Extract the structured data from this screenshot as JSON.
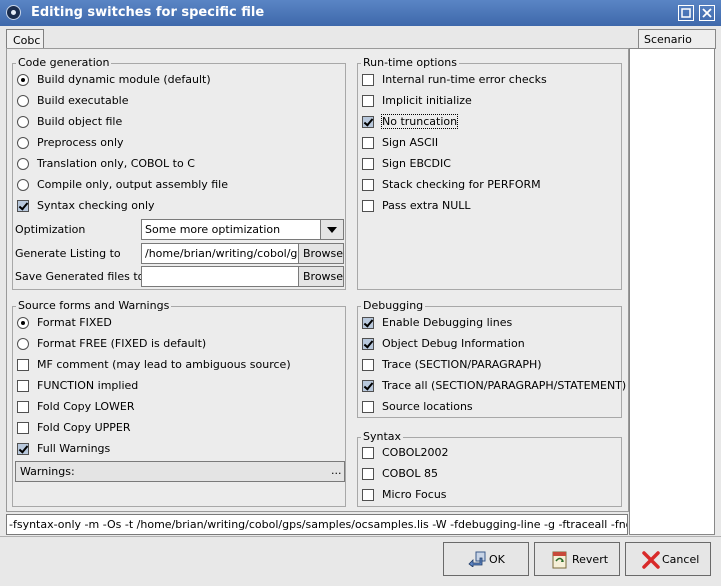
{
  "window": {
    "title": "Editing switches for specific file"
  },
  "tabs": [
    {
      "label": "Cobc"
    }
  ],
  "scenario": {
    "header": "Scenario"
  },
  "code_generation": {
    "title": "Code generation",
    "radios": [
      {
        "label": "Build dynamic module (default)",
        "selected": true
      },
      {
        "label": "Build executable",
        "selected": false
      },
      {
        "label": "Build object file",
        "selected": false
      },
      {
        "label": "Preprocess only",
        "selected": false
      },
      {
        "label": "Translation only, COBOL to C",
        "selected": false
      },
      {
        "label": "Compile only, output assembly file",
        "selected": false
      }
    ],
    "syntax_only": {
      "label": "Syntax checking only",
      "checked": true
    },
    "optimization": {
      "label": "Optimization",
      "value": "Some more optimization"
    },
    "listing": {
      "label": "Generate Listing to",
      "value": "/home/brian/writing/cobol/gps/samples/ocsamples.lis",
      "button": "Browse"
    },
    "save_generated": {
      "label": "Save Generated files to",
      "value": "",
      "button": "Browse"
    }
  },
  "runtime_options": {
    "title": "Run-time options",
    "items": [
      {
        "label": "Internal run-time error checks",
        "checked": false
      },
      {
        "label": "Implicit initialize",
        "checked": false
      },
      {
        "label": "No truncation",
        "checked": true
      },
      {
        "label": "Sign ASCII",
        "checked": false
      },
      {
        "label": "Sign EBCDIC",
        "checked": false
      },
      {
        "label": "Stack checking for PERFORM",
        "checked": false
      },
      {
        "label": "Pass extra NULL",
        "checked": false
      }
    ]
  },
  "source_forms": {
    "title": "Source forms and Warnings",
    "radios": [
      {
        "label": "Format FIXED",
        "selected": true
      },
      {
        "label": "Format FREE (FIXED is default)",
        "selected": false
      }
    ],
    "checks": [
      {
        "label": "MF comment (may lead to ambiguous source)",
        "checked": false
      },
      {
        "label": "FUNCTION implied",
        "checked": false
      },
      {
        "label": "Fold Copy LOWER",
        "checked": false
      },
      {
        "label": "Fold Copy UPPER",
        "checked": false
      },
      {
        "label": "Full Warnings",
        "checked": true
      }
    ],
    "warnings": {
      "label": "Warnings:",
      "button": "..."
    }
  },
  "debugging": {
    "title": "Debugging",
    "items": [
      {
        "label": "Enable Debugging lines",
        "checked": true
      },
      {
        "label": "Object Debug Information",
        "checked": true
      },
      {
        "label": "Trace (SECTION/PARAGRAPH)",
        "checked": false
      },
      {
        "label": "Trace all (SECTION/PARAGRAPH/STATEMENT)",
        "checked": true
      },
      {
        "label": "Source locations",
        "checked": false
      }
    ]
  },
  "syntax": {
    "title": "Syntax",
    "items": [
      {
        "label": "COBOL2002",
        "checked": false
      },
      {
        "label": "COBOL 85",
        "checked": false
      },
      {
        "label": "Micro Focus",
        "checked": false
      }
    ]
  },
  "command_line": "-fsyntax-only -m -Os -t /home/brian/writing/cobol/gps/samples/ocsamples.lis -W -fdebugging-line -g -ftraceall -fnotrunc",
  "buttons": {
    "ok": "OK",
    "revert": "Revert",
    "cancel": "Cancel"
  },
  "icons": {
    "app": "app-menu-icon",
    "maximize": "maximize-icon",
    "close": "close-icon",
    "dropdown": "chevron-down-icon",
    "ok": "ok-arrow-icon",
    "revert": "revert-icon",
    "cancel": "cancel-x-icon"
  },
  "colors": {
    "titlebar": "#4a76b8",
    "check_fill": "#b8c8dc"
  }
}
